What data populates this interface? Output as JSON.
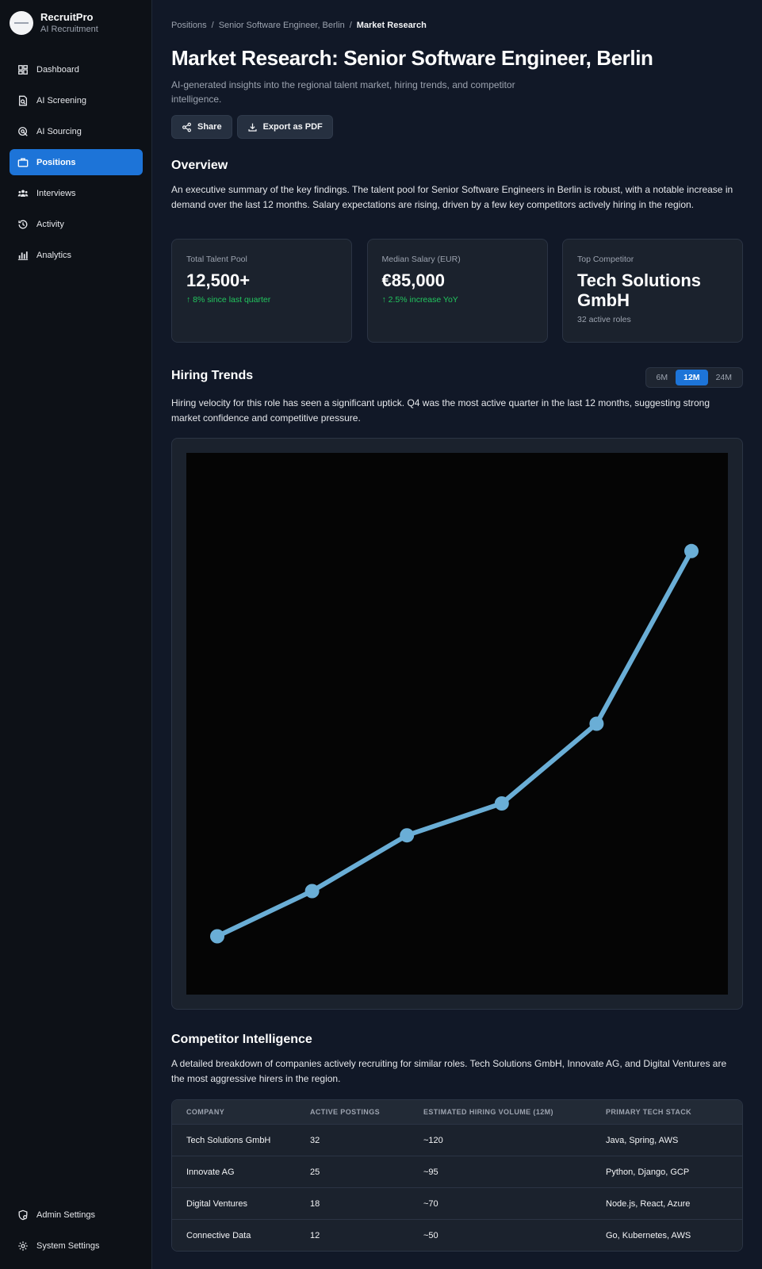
{
  "brand": {
    "name": "RecruitPro",
    "subtitle": "AI Recruitment"
  },
  "nav": {
    "items": [
      {
        "label": "Dashboard",
        "icon": "dashboard-icon",
        "active": false
      },
      {
        "label": "AI Screening",
        "icon": "document-search-icon",
        "active": false
      },
      {
        "label": "AI Sourcing",
        "icon": "radar-icon",
        "active": false
      },
      {
        "label": "Positions",
        "icon": "briefcase-icon",
        "active": true
      },
      {
        "label": "Interviews",
        "icon": "people-icon",
        "active": false
      },
      {
        "label": "Activity",
        "icon": "history-icon",
        "active": false
      },
      {
        "label": "Analytics",
        "icon": "bar-chart-icon",
        "active": false
      }
    ],
    "bottom": [
      {
        "label": "Admin Settings",
        "icon": "admin-shield-icon"
      },
      {
        "label": "System Settings",
        "icon": "gear-icon"
      }
    ]
  },
  "breadcrumb": {
    "items": [
      "Positions",
      "Senior Software Engineer, Berlin"
    ],
    "current": "Market Research",
    "separator": "/"
  },
  "page": {
    "title": "Market Research: Senior Software Engineer, Berlin",
    "subtitle": "AI-generated insights into the regional talent market, hiring trends, and competitor intelligence."
  },
  "actions": {
    "share": "Share",
    "export": "Export as PDF"
  },
  "overview": {
    "heading": "Overview",
    "text": "An executive summary of the key findings. The talent pool for Senior Software Engineers in Berlin is robust, with a notable increase in demand over the last 12 months. Salary expectations are rising, driven by a few key competitors actively hiring in the region.",
    "stats": [
      {
        "label": "Total Talent Pool",
        "value": "12,500+",
        "trend": "↑ 8% since last quarter"
      },
      {
        "label": "Median Salary (EUR)",
        "value": "€85,000",
        "trend": "↑ 2.5% increase YoY"
      },
      {
        "label": "Top Competitor",
        "value": "Tech Solutions GmbH",
        "note": "32 active roles"
      }
    ]
  },
  "hiring": {
    "heading": "Hiring Trends",
    "ranges": [
      "6M",
      "12M",
      "24M"
    ],
    "selected_range": "12M",
    "text": "Hiring velocity for this role has seen a significant uptick. Q4 was the most active quarter in the last 12 months, suggesting strong market confidence and competitive pressure."
  },
  "chart_data": {
    "type": "line",
    "x": [
      1,
      2,
      3,
      4,
      5,
      6
    ],
    "values": [
      5,
      13.5,
      24,
      30,
      45,
      77.5
    ],
    "ylim": [
      0,
      90
    ],
    "colors": {
      "line": "#6aaed6",
      "background": "#050505"
    }
  },
  "competitors": {
    "heading": "Competitor Intelligence",
    "text": "A detailed breakdown of companies actively recruiting for similar roles. Tech Solutions GmbH, Innovate AG, and Digital Ventures are the most aggressive hirers in the region.",
    "columns": [
      "COMPANY",
      "ACTIVE POSTINGS",
      "ESTIMATED HIRING VOLUME (12M)",
      "PRIMARY TECH STACK"
    ],
    "rows": [
      [
        "Tech Solutions GmbH",
        "32",
        "~120",
        "Java, Spring, AWS"
      ],
      [
        "Innovate AG",
        "25",
        "~95",
        "Python, Django, GCP"
      ],
      [
        "Digital Ventures",
        "18",
        "~70",
        "Node.js, React, Azure"
      ],
      [
        "Connective Data",
        "12",
        "~50",
        "Go, Kubernetes, AWS"
      ]
    ]
  },
  "colors": {
    "accent": "#1d74d8",
    "positive": "#22c55e"
  }
}
